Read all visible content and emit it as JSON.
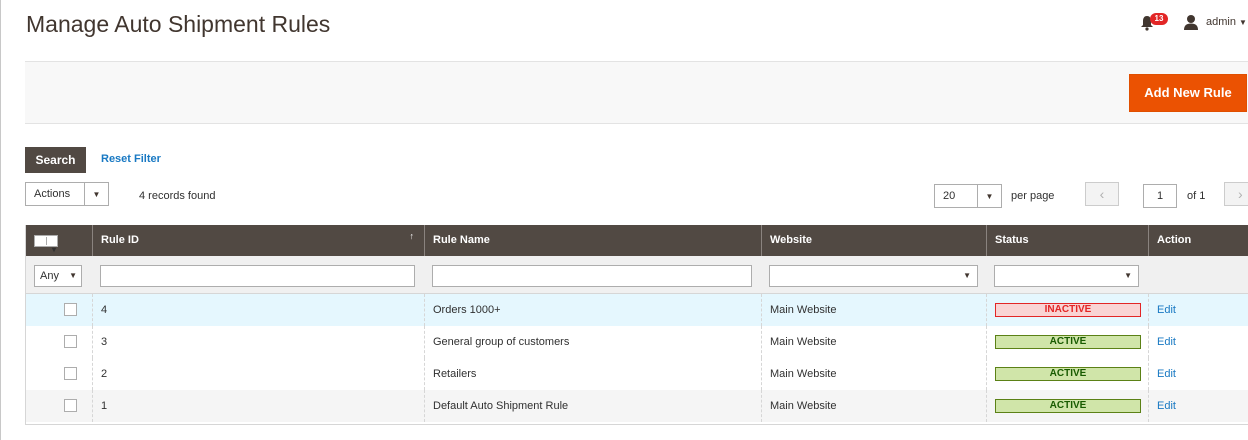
{
  "header": {
    "title": "Manage Auto Shipment Rules",
    "notification_count": "13",
    "user_name": "admin"
  },
  "toolbar": {
    "add_button": "Add New Rule"
  },
  "filters": {
    "search_button": "Search",
    "reset_link": "Reset Filter",
    "actions_label": "Actions",
    "records_found": "4 records found",
    "per_page_value": "20",
    "per_page_label": "per page",
    "current_page": "1",
    "page_of": "of 1"
  },
  "grid": {
    "columns": [
      "Rule ID",
      "Rule Name",
      "Website",
      "Status",
      "Action"
    ],
    "filter_any": "Any",
    "rows": [
      {
        "id": "4",
        "name": "Orders 1000+",
        "website": "Main Website",
        "status": "INACTIVE",
        "action": "Edit"
      },
      {
        "id": "3",
        "name": "General group of customers",
        "website": "Main Website",
        "status": "ACTIVE",
        "action": "Edit"
      },
      {
        "id": "2",
        "name": "Retailers",
        "website": "Main Website",
        "status": "ACTIVE",
        "action": "Edit"
      },
      {
        "id": "1",
        "name": "Default Auto Shipment Rule",
        "website": "Main Website",
        "status": "ACTIVE",
        "action": "Edit"
      }
    ]
  },
  "colors": {
    "accent": "#eb5202",
    "header_bg": "#514943",
    "link": "#1979c3",
    "active_bg": "#d0e5a9",
    "inactive_bg": "#f9d4d4"
  },
  "icons": [
    "bell-icon",
    "user-icon",
    "chevron-down-icon",
    "chevron-left-icon",
    "chevron-right-icon",
    "sort-arrow-icon"
  ]
}
